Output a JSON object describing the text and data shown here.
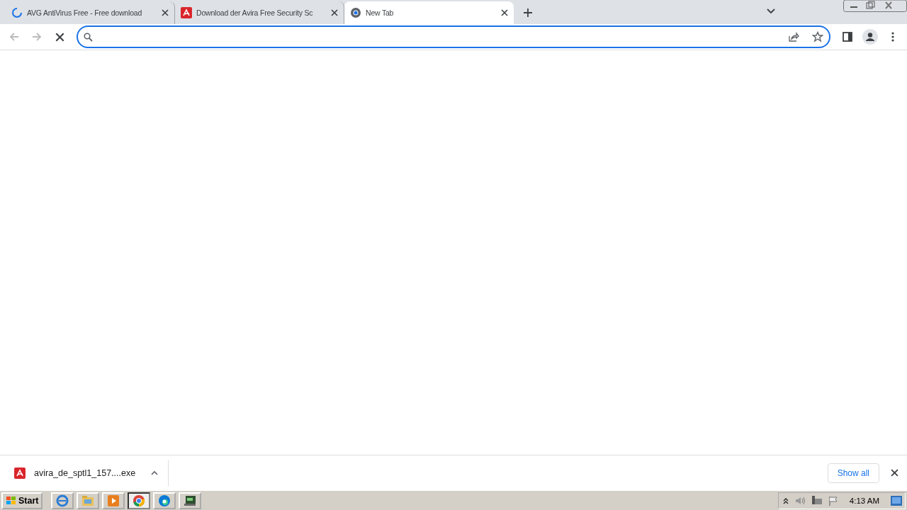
{
  "tabs": [
    {
      "title": "AVG AntiVirus Free - Free download",
      "kind": "loading",
      "selected": false
    },
    {
      "title": "Download der Avira Free Security Sc",
      "kind": "avira",
      "selected": false
    },
    {
      "title": "New Tab",
      "kind": "newtab",
      "selected": true
    }
  ],
  "download": {
    "filename": "avira_de_sptl1_157....exe",
    "show_all": "Show all"
  },
  "taskbar": {
    "start": "Start",
    "apps": [
      {
        "kind": "ie",
        "selected": false
      },
      {
        "kind": "folder",
        "selected": false
      },
      {
        "kind": "media",
        "selected": false
      },
      {
        "kind": "chrome",
        "selected": true
      },
      {
        "kind": "edge",
        "selected": false
      },
      {
        "kind": "terminal",
        "selected": false
      }
    ],
    "clock": "4:13 AM"
  }
}
